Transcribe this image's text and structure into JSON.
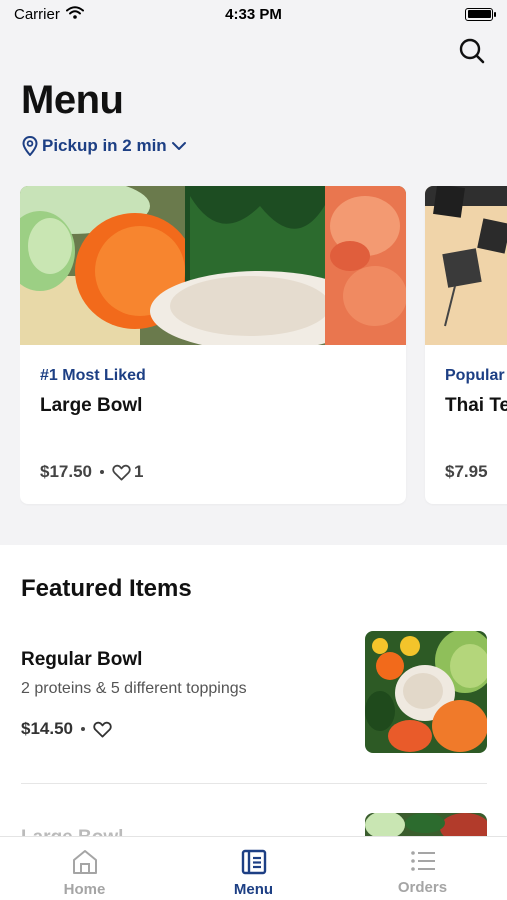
{
  "status_bar": {
    "carrier": "Carrier",
    "time": "4:33 PM"
  },
  "header": {
    "title": "Menu",
    "pickup_label": "Pickup in 2 min"
  },
  "carousel": [
    {
      "tag": "#1 Most Liked",
      "name": "Large Bowl",
      "price": "$17.50",
      "likes": "1"
    },
    {
      "tag": "Popular",
      "name": "Thai Te",
      "price": "$7.95"
    }
  ],
  "featured": {
    "title": "Featured Items",
    "items": [
      {
        "name": "Regular Bowl",
        "description": "2 proteins & 5 different toppings",
        "price": "$14.50"
      },
      {
        "name": "Large Bowl"
      }
    ]
  },
  "tabs": [
    {
      "label": "Home",
      "icon": "home-icon",
      "active": false
    },
    {
      "label": "Menu",
      "icon": "menu-book-icon",
      "active": true
    },
    {
      "label": "Orders",
      "icon": "list-icon",
      "active": false
    }
  ],
  "colors": {
    "accent": "#1d3f84",
    "background": "#f3f3f5",
    "inactive": "#a5a5a5"
  }
}
